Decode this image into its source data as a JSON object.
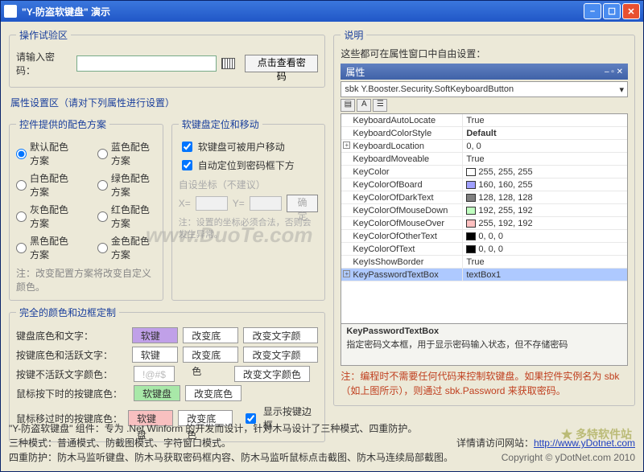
{
  "title": "\"Y-防盗软键盘\" 演示",
  "section_test": "操作试验区",
  "pwd_label": "请输入密码：",
  "view_pwd_btn": "点击查看密码",
  "section_attr": "属性设置区（请对下列属性进行设置）",
  "group_color": "控件提供的配色方案",
  "radios": [
    [
      "默认配色方案",
      "蓝色配色方案"
    ],
    [
      "白色配色方案",
      "绿色配色方案"
    ],
    [
      "灰色配色方案",
      "红色配色方案"
    ],
    [
      "黑色配色方案",
      "金色配色方案"
    ]
  ],
  "color_note": "注：改变配置方案将改变自定义颜色。",
  "group_pos": "软键盘定位和移动",
  "chk_move": "软键盘可被用户移动",
  "chk_auto": "自动定位到密码框下方",
  "custom_xy_label": "自设坐标（不建议）",
  "confirm_btn": "确定",
  "xy_note": "注：设置的坐标必须合法，否则会发生异常。",
  "group_custom": "完全的颜色和边框定制",
  "cust_rows": [
    "键盘底色和文字：",
    "按键底色和活跃文字：",
    "按键不活跃文字颜色：",
    "鼠标按下时的按键底色：",
    "鼠标移过时的按键底色："
  ],
  "chip_soft": "软键盘",
  "chip_bg": "改变底色",
  "chip_txt": "改变文字颜色",
  "chip_demo_faded": "!@#$",
  "chk_border": "显示按键边框",
  "section_desc": "说明",
  "desc_line": "这些都可在属性窗口中自由设置：",
  "prop_title": "属性",
  "prop_selector": "sbk Y.Booster.Security.SoftKeyboardButton",
  "props": [
    {
      "k": "KeyboardAutoLocate",
      "v": "True"
    },
    {
      "k": "KeyboardColorStyle",
      "v": "Default",
      "bold": true
    },
    {
      "k": "KeyboardLocation",
      "v": "0, 0",
      "exp": true
    },
    {
      "k": "KeyboardMoveable",
      "v": "True"
    },
    {
      "k": "KeyColor",
      "v": "255, 255, 255",
      "c": "#ffffff"
    },
    {
      "k": "KeyColorOfBoard",
      "v": "160, 160, 255",
      "c": "#a0a0ff"
    },
    {
      "k": "KeyColorOfDarkText",
      "v": "128, 128, 128",
      "c": "#808080"
    },
    {
      "k": "KeyColorOfMouseDown",
      "v": "192, 255, 192",
      "c": "#c0ffc0"
    },
    {
      "k": "KeyColorOfMouseOver",
      "v": "255, 192, 192",
      "c": "#ffc0c0"
    },
    {
      "k": "KeyColorOfOtherText",
      "v": "0, 0, 0",
      "c": "#000000"
    },
    {
      "k": "KeyColorOfText",
      "v": "0, 0, 0",
      "c": "#000000"
    },
    {
      "k": "KeyIsShowBorder",
      "v": "True"
    },
    {
      "k": "KeyPasswordTextBox",
      "v": "textBox1",
      "exp": true,
      "sel": true
    }
  ],
  "prop_desc_title": "KeyPasswordTextBox",
  "prop_desc_body": "指定密码文本框，用于显示密码输入状态，但不存储密码",
  "code_note": "注：编程时不需要任何代码来控制软键盘。如果控件实例名为 sbk（如上图所示），则通过 sbk.Password 来获取密码。",
  "footer1": "\"Y-防盗软键盘\" 组件：专为 .Net Winform 的开发而设计，针对木马设计了三种模式、四重防护。",
  "footer2": "三种模式：普通模式、防截图模式、字符窗口模式。",
  "footer3": "四重防护：防木马监听键盘、防木马获取密码框内容、防木马监听鼠标点击截图、防木马连续局部截图。",
  "site_label": "详情请访问网站：",
  "site_url": "http://www.yDotnet.com",
  "copyright": "Copyright © yDotNet.com 2010",
  "watermark": "www.DuoTe.com",
  "duote": "多特软件站"
}
